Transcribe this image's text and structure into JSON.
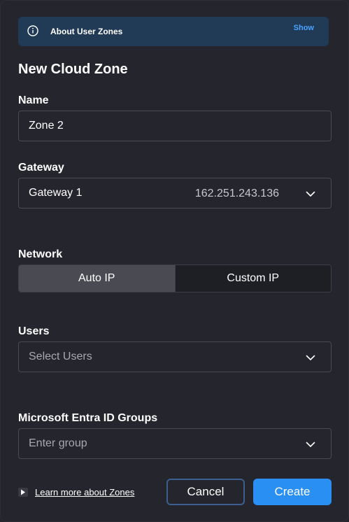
{
  "banner": {
    "title": "About User Zones",
    "action_label": "Show"
  },
  "heading": "New Cloud Zone",
  "name_field": {
    "label": "Name",
    "value": "Zone 2"
  },
  "gateway_field": {
    "label": "Gateway",
    "value": "Gateway 1",
    "ip": "162.251.243.136"
  },
  "network": {
    "label": "Network",
    "options": [
      "Auto IP",
      "Custom IP"
    ],
    "selected": "Auto IP"
  },
  "users_field": {
    "label": "Users",
    "placeholder": "Select Users"
  },
  "groups_field": {
    "label": "Microsoft Entra ID Groups",
    "placeholder": "Enter group"
  },
  "footer": {
    "learn_more": "Learn more about Zones",
    "cancel_label": "Cancel",
    "create_label": "Create"
  },
  "colors": {
    "accent": "#2a8ff3",
    "banner_bg": "#213a55",
    "link": "#4aa3ff",
    "background": "#25252d"
  }
}
